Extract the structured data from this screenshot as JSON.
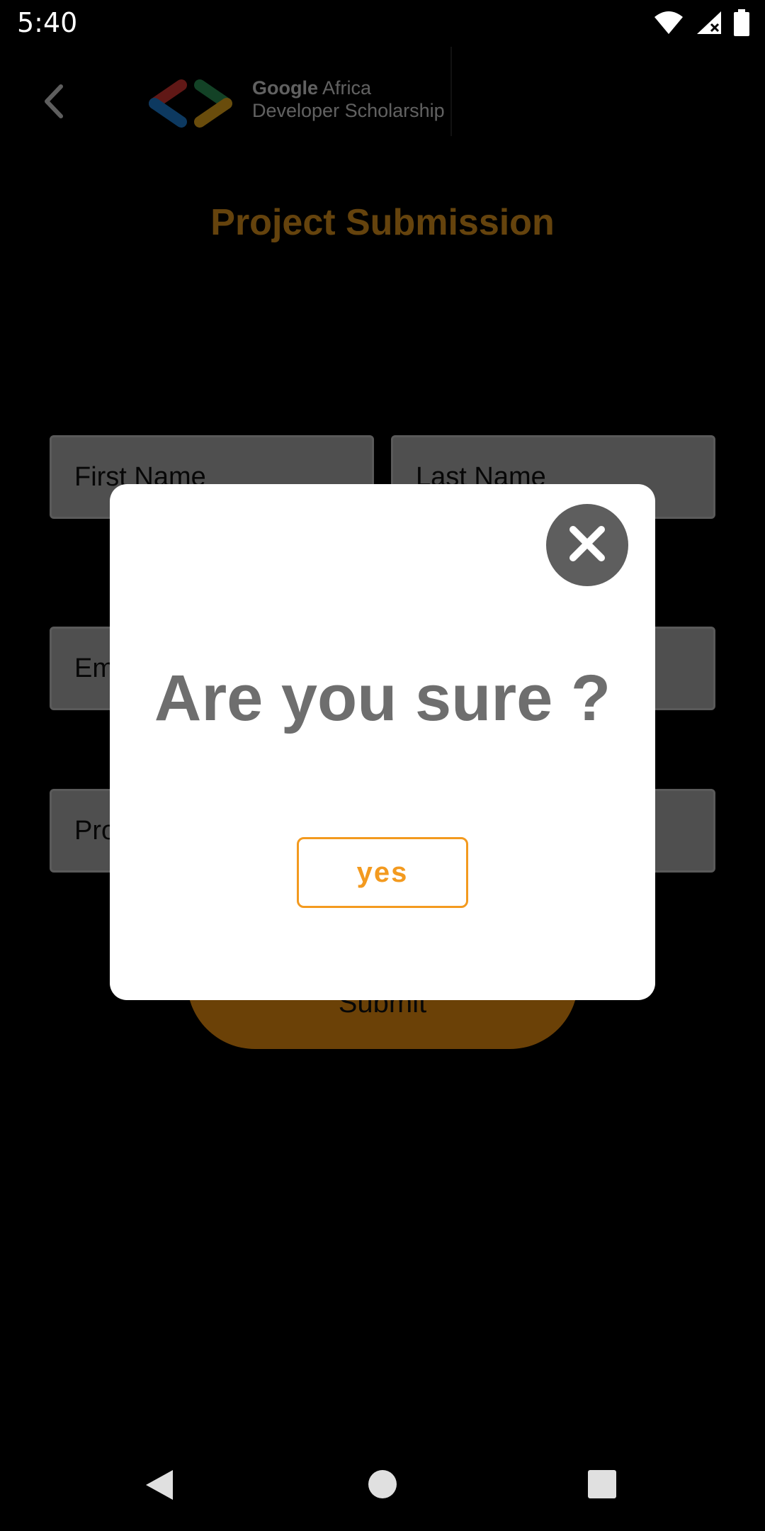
{
  "status_bar": {
    "time": "5:40"
  },
  "header": {
    "brand_line1_bold": "Google",
    "brand_line1_rest": " Africa",
    "brand_line2": "Developer Scholarship"
  },
  "form": {
    "title": "Project Submission",
    "first_name_placeholder": "First Name",
    "last_name_placeholder": "Last Name",
    "email_placeholder": "Em",
    "project_placeholder": "Pro",
    "submit_label": "Submit"
  },
  "dialog": {
    "title": "Are you sure ?",
    "confirm_label": "yes"
  },
  "colors": {
    "accent": "#f39a1f",
    "dialog_text": "#6e6e6e",
    "close_button": "#5e5e5e"
  },
  "icons": [
    "wifi-icon",
    "signal-icon",
    "battery-icon",
    "back-arrow-icon",
    "gads-logo",
    "close-icon",
    "nav-back-icon",
    "nav-home-icon",
    "nav-recents-icon"
  ]
}
